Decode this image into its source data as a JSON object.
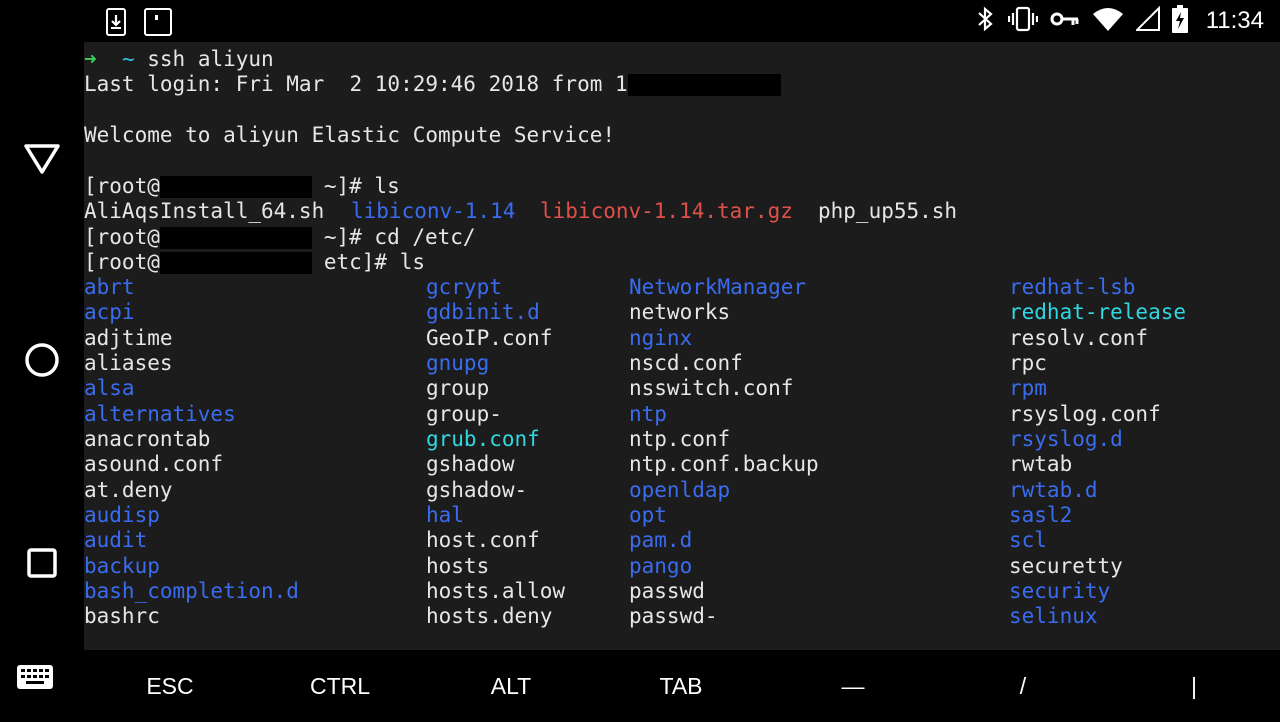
{
  "status_bar": {
    "time": "11:34",
    "left_icons": [
      "download-notification-icon",
      "screenshot-notification-icon"
    ],
    "right_icons": [
      "bluetooth-icon",
      "vibrate-icon",
      "vpn-key-icon",
      "wifi-icon",
      "cell-signal-icon",
      "battery-charging-icon"
    ]
  },
  "nav_bar": {
    "buttons": [
      "back-triangle-icon",
      "home-circle-icon",
      "recents-square-icon"
    ]
  },
  "terminal": {
    "prompt_arrow": "➜",
    "prompt_tilde": "~",
    "cmd_ssh": "ssh aliyun",
    "last_login": "Last login: Fri Mar  2 10:29:46 2018 from 1",
    "welcome": "Welcome to aliyun Elastic Compute Service!",
    "root_open": "[root@",
    "prompt_home_ls": "~]# ls",
    "prompt_home_cd": "~]# cd /etc/",
    "prompt_etc_ls": "etc]# ls",
    "home_listing": [
      {
        "name": "AliAqsInstall_64.sh",
        "color": "white"
      },
      {
        "name": "libiconv-1.14",
        "color": "blue"
      },
      {
        "name": "libiconv-1.14.tar.gz",
        "color": "red"
      },
      {
        "name": "php_up55.sh",
        "color": "white"
      }
    ],
    "etc_listing": {
      "col1": [
        {
          "name": "abrt",
          "color": "blue"
        },
        {
          "name": "acpi",
          "color": "blue"
        },
        {
          "name": "adjtime",
          "color": "white"
        },
        {
          "name": "aliases",
          "color": "white"
        },
        {
          "name": "alsa",
          "color": "blue"
        },
        {
          "name": "alternatives",
          "color": "blue"
        },
        {
          "name": "anacrontab",
          "color": "white"
        },
        {
          "name": "asound.conf",
          "color": "white"
        },
        {
          "name": "at.deny",
          "color": "white"
        },
        {
          "name": "audisp",
          "color": "blue"
        },
        {
          "name": "audit",
          "color": "blue"
        },
        {
          "name": "backup",
          "color": "blue"
        },
        {
          "name": "bash_completion.d",
          "color": "blue"
        },
        {
          "name": "bashrc",
          "color": "white"
        }
      ],
      "col2": [
        {
          "name": "gcrypt",
          "color": "blue"
        },
        {
          "name": "gdbinit.d",
          "color": "blue"
        },
        {
          "name": "GeoIP.conf",
          "color": "white"
        },
        {
          "name": "gnupg",
          "color": "blue"
        },
        {
          "name": "group",
          "color": "white"
        },
        {
          "name": "group-",
          "color": "white"
        },
        {
          "name": "grub.conf",
          "color": "cyan"
        },
        {
          "name": "gshadow",
          "color": "white"
        },
        {
          "name": "gshadow-",
          "color": "white"
        },
        {
          "name": "hal",
          "color": "blue"
        },
        {
          "name": "host.conf",
          "color": "white"
        },
        {
          "name": "hosts",
          "color": "white"
        },
        {
          "name": "hosts.allow",
          "color": "white"
        },
        {
          "name": "hosts.deny",
          "color": "white"
        }
      ],
      "col3": [
        {
          "name": "NetworkManager",
          "color": "blue"
        },
        {
          "name": "networks",
          "color": "white"
        },
        {
          "name": "nginx",
          "color": "blue"
        },
        {
          "name": "nscd.conf",
          "color": "white"
        },
        {
          "name": "nsswitch.conf",
          "color": "white"
        },
        {
          "name": "ntp",
          "color": "blue"
        },
        {
          "name": "ntp.conf",
          "color": "white"
        },
        {
          "name": "ntp.conf.backup",
          "color": "white"
        },
        {
          "name": "openldap",
          "color": "blue"
        },
        {
          "name": "opt",
          "color": "blue"
        },
        {
          "name": "pam.d",
          "color": "blue"
        },
        {
          "name": "pango",
          "color": "blue"
        },
        {
          "name": "passwd",
          "color": "white"
        },
        {
          "name": "passwd-",
          "color": "white"
        }
      ],
      "col4": [
        {
          "name": "redhat-lsb",
          "color": "blue"
        },
        {
          "name": "redhat-release",
          "color": "cyan"
        },
        {
          "name": "resolv.conf",
          "color": "white"
        },
        {
          "name": "rpc",
          "color": "white"
        },
        {
          "name": "rpm",
          "color": "blue"
        },
        {
          "name": "rsyslog.conf",
          "color": "white"
        },
        {
          "name": "rsyslog.d",
          "color": "blue"
        },
        {
          "name": "rwtab",
          "color": "white"
        },
        {
          "name": "rwtab.d",
          "color": "blue"
        },
        {
          "name": "sasl2",
          "color": "blue"
        },
        {
          "name": "scl",
          "color": "blue"
        },
        {
          "name": "securetty",
          "color": "white"
        },
        {
          "name": "security",
          "color": "blue"
        },
        {
          "name": "selinux",
          "color": "blue"
        }
      ]
    }
  },
  "extra_keys": {
    "toggle_icon": "keyboard-icon",
    "keys": [
      "ESC",
      "CTRL",
      "ALT",
      "TAB",
      "—",
      "/",
      "|"
    ]
  },
  "colors": {
    "terminal_bg": "#1c1c1c",
    "text_white": "#e6e6e6",
    "dir_blue": "#3a6cf0",
    "link_cyan": "#2fd8e0",
    "archive_red": "#e0504a",
    "prompt_green": "#3ecf5a"
  }
}
